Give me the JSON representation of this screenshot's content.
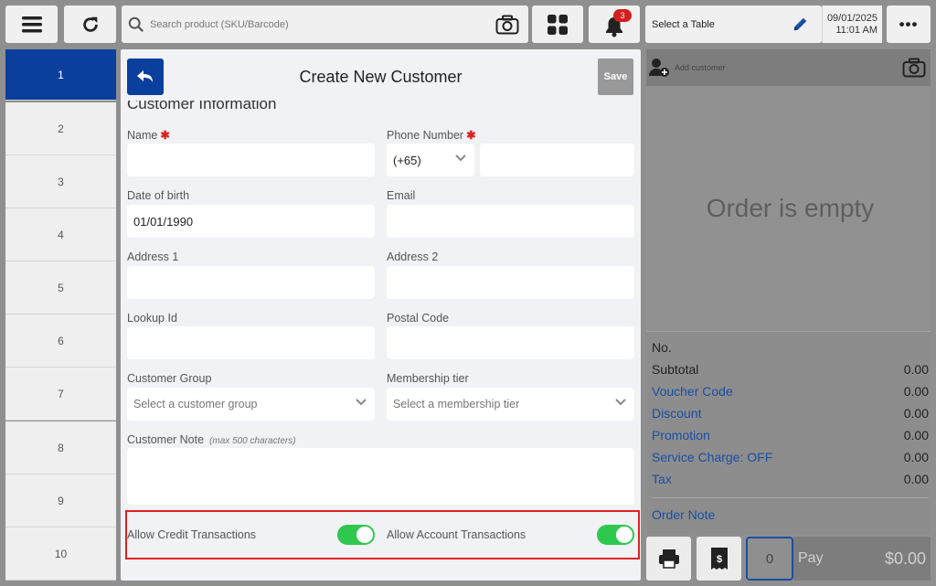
{
  "topbar": {
    "search_placeholder": "Search product (SKU/Barcode)",
    "notification_count": "3",
    "table_label": "Select a Table",
    "date": "09/01/2025",
    "time": "11:01 AM",
    "more": "•••"
  },
  "sidebar": {
    "items": [
      "1",
      "2",
      "3",
      "4",
      "5",
      "6",
      "7",
      "8",
      "9",
      "10"
    ],
    "active": "1"
  },
  "modal": {
    "title": "Create New Customer",
    "save_label": "Save",
    "section_title": "Customer Information",
    "fields": {
      "name_label": "Name",
      "phone_label": "Phone Number",
      "phone_code": "(+65)",
      "dob_label": "Date of birth",
      "dob_value": "01/01/1990",
      "email_label": "Email",
      "address1_label": "Address 1",
      "address2_label": "Address 2",
      "lookup_label": "Lookup Id",
      "postal_label": "Postal Code",
      "group_label": "Customer Group",
      "group_placeholder": "Select a customer group",
      "tier_label": "Membership tier",
      "tier_placeholder": "Select a membership tier",
      "note_label": "Customer Note",
      "note_hint": "(max 500 characters)",
      "credit_label": "Allow Credit Transactions",
      "account_label": "Allow Account Transactions"
    },
    "toggles": {
      "credit": true,
      "account": true
    }
  },
  "order": {
    "add_customer": "Add customer",
    "empty_text": "Order is empty",
    "no_label": "No.",
    "summary": [
      {
        "label": "Subtotal",
        "value": "0.00",
        "link": false
      },
      {
        "label": "Voucher Code",
        "value": "0.00",
        "link": true
      },
      {
        "label": "Discount",
        "value": "0.00",
        "link": true
      },
      {
        "label": "Promotion",
        "value": "0.00",
        "link": true
      },
      {
        "label": "Service Charge: OFF",
        "value": "0.00",
        "link": true
      },
      {
        "label": "Tax",
        "value": "0.00",
        "link": true
      }
    ],
    "order_note": "Order Note",
    "qty": "0",
    "pay_label": "Pay",
    "pay_amount": "$0.00"
  },
  "colors": {
    "active_nav": "#0a3f9e",
    "toggle_on": "#2ec84e",
    "highlight": "#e02020",
    "link": "#1a4fa3"
  }
}
